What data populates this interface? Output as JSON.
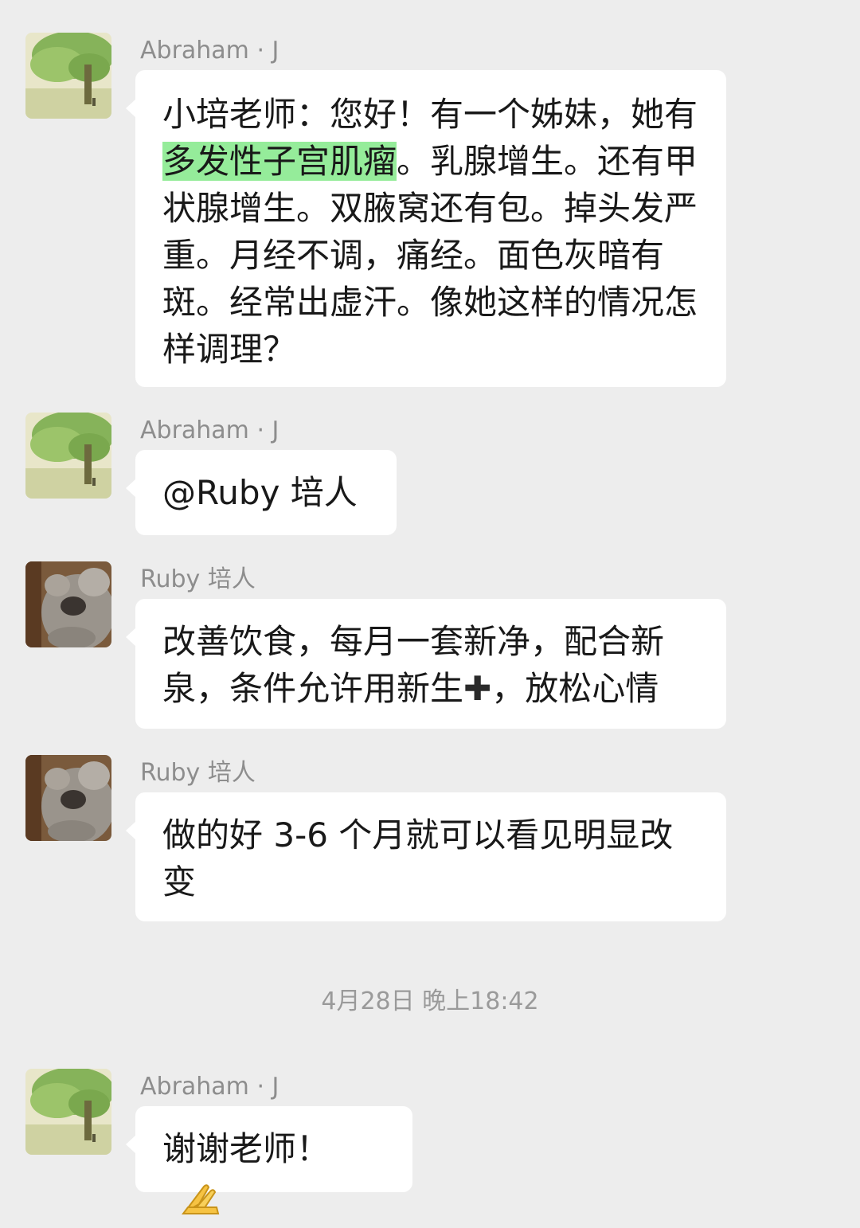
{
  "messages": [
    {
      "sender": "Abraham · J",
      "avatar": "tree-avatar-icon",
      "text_before": "小培老师：您好！有一个姊妹，她有",
      "text_highlight": "多发性子宫肌瘤",
      "text_after": "。乳腺增生。还有甲状腺增生。双腋窝还有包。掉头发严重。月经不调，痛经。面色灰暗有斑。经常出虚汗。像她这样的情况怎样调理？"
    },
    {
      "sender": "Abraham · J",
      "avatar": "tree-avatar-icon",
      "text": "@Ruby 培人"
    },
    {
      "sender": "Ruby 培人",
      "avatar": "koala-avatar-icon",
      "text_before": "改善饮食，每月一套新净，配合新泉，条件允许用新生",
      "plus_glyph": "✚",
      "text_after": "，放松心情"
    },
    {
      "sender": "Ruby 培人",
      "avatar": "koala-avatar-icon",
      "text": "做的好 3-6 个月就可以看见明显改变"
    },
    {
      "sender": "Abraham · J",
      "avatar": "tree-avatar-icon",
      "text": "谢谢老师！",
      "emoji": "folded-hands-icon"
    }
  ],
  "timestamp": "4月28日 晚上18:42",
  "colors": {
    "background": "#ededed",
    "bubble": "#ffffff",
    "highlight": "#95ec9a",
    "sender_text": "#8d8d8d",
    "timestamp_text": "#9a9a9a"
  }
}
